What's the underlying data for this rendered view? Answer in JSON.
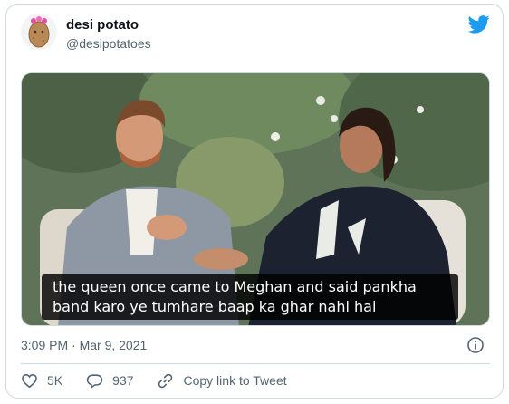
{
  "tweet": {
    "author": {
      "display_name": "desi potato",
      "handle": "@desipotatoes",
      "avatar_icon": "potato-avatar"
    },
    "media": {
      "subtitle_lines": [
        "the queen once came to Meghan and said pankha",
        "band karo ye tumhare baap ka ghar nahi hai"
      ]
    },
    "timestamp": "3:09 PM · Mar 9, 2021",
    "actions": {
      "like_count": "5K",
      "reply_count": "937",
      "copy_link_label": "Copy link to Tweet"
    }
  },
  "colors": {
    "brand_blue": "#1d9bf0",
    "like_red": "#f91880",
    "secondary_text": "#536471",
    "border": "#cfd9de"
  }
}
